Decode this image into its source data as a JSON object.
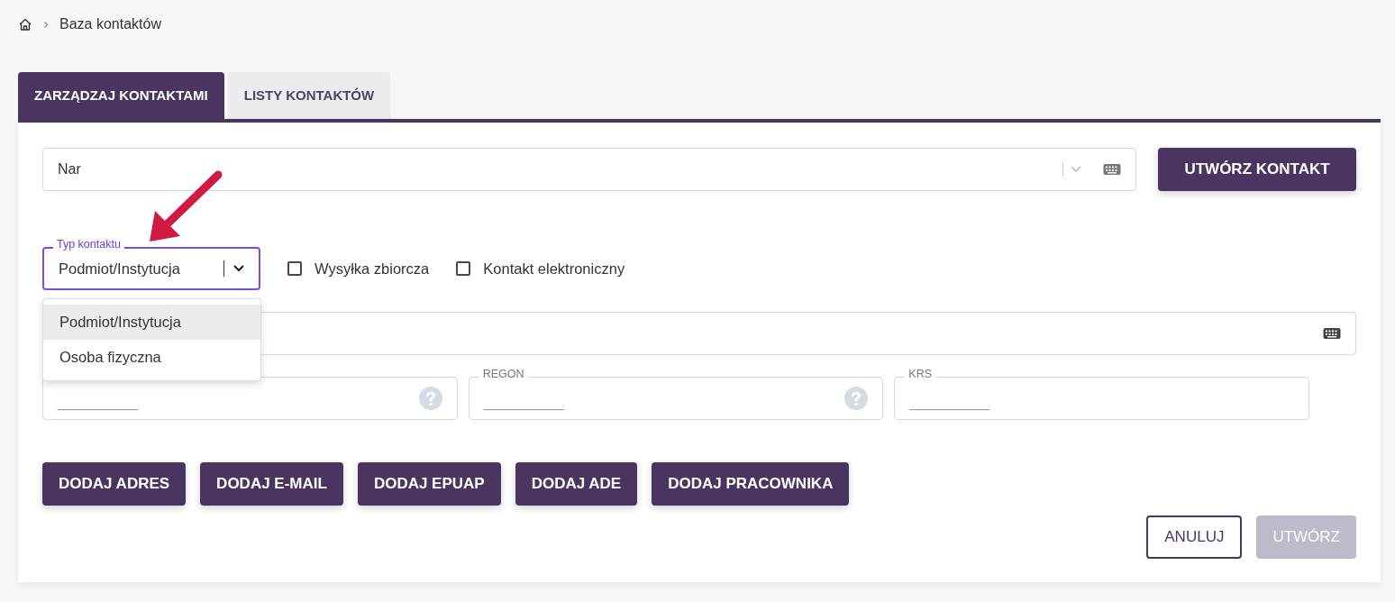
{
  "breadcrumb": {
    "current": "Baza kontaktów"
  },
  "tabs": [
    {
      "label": "ZARZĄDZAJ KONTAKTAMI",
      "selected": true
    },
    {
      "label": "LISTY KONTAKTÓW",
      "selected": false
    }
  ],
  "search": {
    "value": "Nar"
  },
  "create_contact_button": "UTWÓRZ KONTAKT",
  "contact_type": {
    "label": "Typ kontaktu",
    "value": "Podmiot/Instytucja",
    "expanded": true,
    "options": [
      {
        "label": "Podmiot/Instytucja",
        "selected": true
      },
      {
        "label": "Osoba fizyczna",
        "selected": false
      }
    ]
  },
  "checkboxes": [
    {
      "label": "Wysyłka zbiorcza",
      "checked": false
    },
    {
      "label": "Kontakt elektroniczny",
      "checked": false
    }
  ],
  "id_fields": [
    {
      "placeholder": "__________",
      "help": true
    },
    {
      "label": "REGON",
      "placeholder": "__________",
      "help": true
    },
    {
      "label": "KRS",
      "placeholder": "__________",
      "help": false
    }
  ],
  "add_buttons": [
    "DODAJ ADRES",
    "DODAJ E-MAIL",
    "DODAJ EPUAP",
    "DODAJ ADE",
    "DODAJ PRACOWNIKA"
  ],
  "actions": [
    {
      "label": "ANULUJ",
      "kind": "outline",
      "disabled": false
    },
    {
      "label": "UTWÓRZ",
      "kind": "primary",
      "disabled": true
    }
  ]
}
